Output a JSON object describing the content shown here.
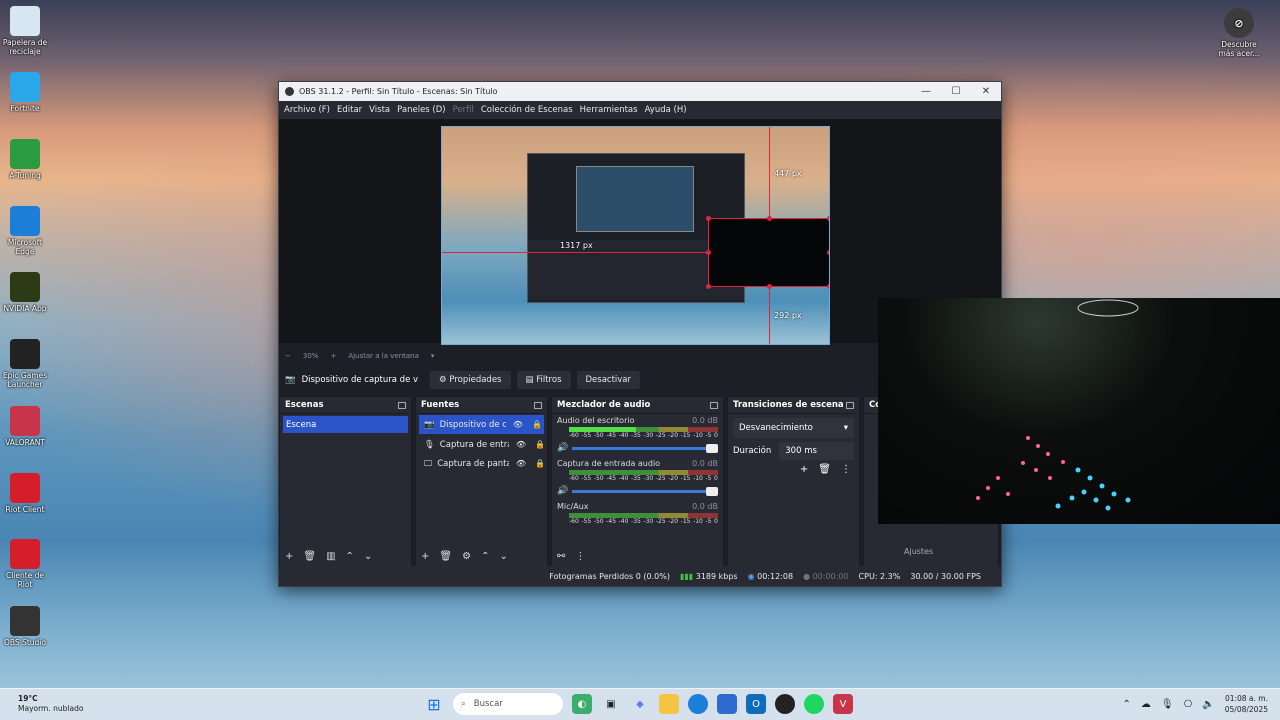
{
  "desktop": {
    "icons_left": [
      {
        "label": "Papelera de reciclaje",
        "icon": "recycle-bin-icon",
        "color": "#d8e6f2"
      },
      {
        "label": "Fortnite",
        "icon": "fortnite-icon",
        "color": "#2aa7e8"
      },
      {
        "label": "A-Tuning",
        "icon": "a-tuning-icon",
        "color": "#2b9b3f"
      },
      {
        "label": "Microsoft Edge",
        "icon": "edge-icon",
        "color": "#1d7ed8"
      },
      {
        "label": "NVIDIA App",
        "icon": "nvidia-icon",
        "color": "#2c3a16"
      },
      {
        "label": "Epic Games Launcher",
        "icon": "epic-games-icon",
        "color": "#222222"
      },
      {
        "label": "VALORANT",
        "icon": "valorant-icon",
        "color": "#c8344a"
      },
      {
        "label": "Riot Client",
        "icon": "riot-client-icon",
        "color": "#d61d2b"
      },
      {
        "label": "Cliente de Riot",
        "icon": "riot-client-icon",
        "color": "#d61d2b"
      },
      {
        "label": "OBS Studio",
        "icon": "obs-icon",
        "color": "#333333"
      }
    ],
    "icon_right": {
      "label": "Descubre más acer...",
      "icon": "compass-icon"
    }
  },
  "obs": {
    "title": "OBS 31.1.2 - Perfil: Sin Título - Escenas: Sin Título",
    "menu": [
      "Archivo (F)",
      "Editar",
      "Vista",
      "Paneles (D)",
      "Perfil",
      "Colección de Escenas",
      "Herramientas",
      "Ayuda (H)"
    ],
    "preview": {
      "px_top": "447 px",
      "px_left": "1317 px",
      "px_bottom": "292 px"
    },
    "zoom": {
      "value": "30%",
      "fit": "Ajustar a la ventana"
    },
    "source_toolbar": {
      "source_name": "Dispositivo de captura de v",
      "properties": "Propiedades",
      "filters": "Filtros",
      "deactivate": "Desactivar"
    },
    "scenes": {
      "title": "Escenas",
      "items": [
        "Escena"
      ]
    },
    "sources": {
      "title": "Fuentes",
      "items": [
        "Dispositivo de cap",
        "Captura de entrad",
        "Captura de pantal"
      ]
    },
    "mixer": {
      "title": "Mezclador de audio",
      "ticks": [
        "-60",
        "-55",
        "-50",
        "-45",
        "-40",
        "-35",
        "-30",
        "-25",
        "-20",
        "-15",
        "-10",
        "-5",
        "0"
      ],
      "channels": [
        {
          "name": "Audio del escritorio",
          "db": "0.0 dB",
          "level": 0.45
        },
        {
          "name": "Captura de entrada audio",
          "db": "0.0 dB",
          "level": 0.0
        },
        {
          "name": "Mic/Aux",
          "db": "0.0 dB",
          "level": 0.0
        }
      ]
    },
    "transitions": {
      "title": "Transiciones de escena",
      "selected": "Desvanecimiento",
      "duration_label": "Duración",
      "duration": "300 ms"
    },
    "controls": {
      "title": "Co",
      "settings": "Ajustes"
    },
    "status": {
      "dropped": "Fotogramas Perdidos 0 (0.0%)",
      "bitrate": "3189 kbps",
      "rec_time": "00:12:08",
      "stream_time": "00:00:00",
      "cpu": "CPU: 2.3%",
      "fps": "30.00 / 30.00 FPS"
    }
  },
  "taskbar": {
    "weather_temp": "19°C",
    "weather_desc": "Mayorm. nublado",
    "search_placeholder": "Buscar",
    "time": "01:08 a. m.",
    "date": "05/08/2025"
  },
  "colors": {
    "accent": "#2c54c9",
    "record_red": "#e0243d",
    "meter_green": "#52e046"
  }
}
